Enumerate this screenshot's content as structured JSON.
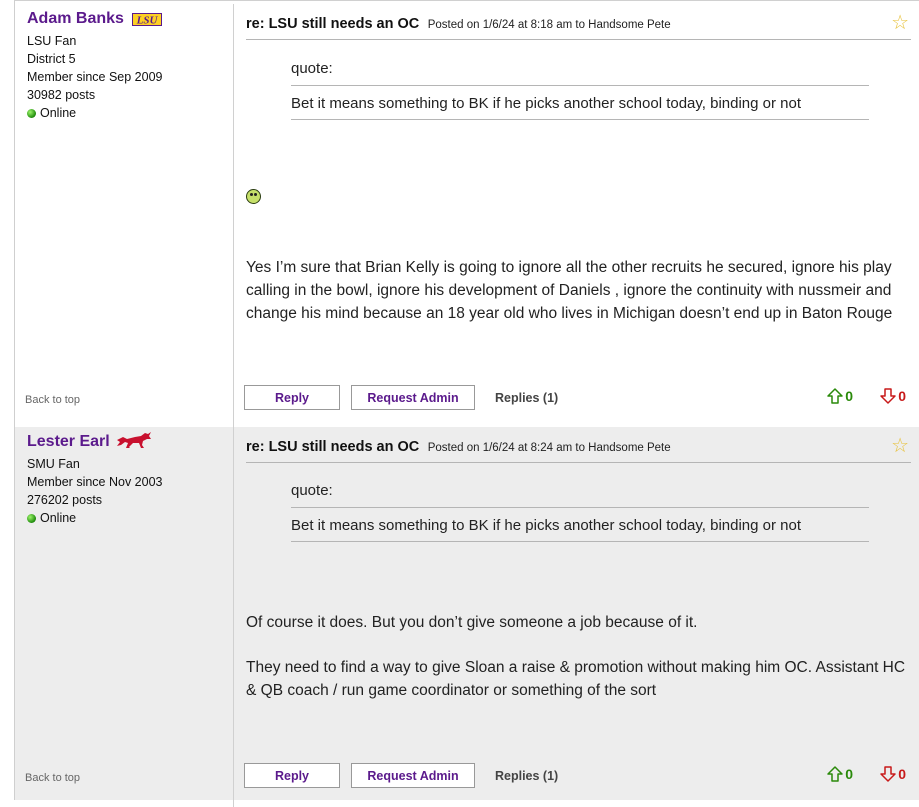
{
  "posts": [
    {
      "author": "Adam Banks",
      "team_logo": "LSU",
      "fan_of": "LSU Fan",
      "district": "District 5",
      "member_since": "Member since Sep 2009",
      "post_count": "30982 posts",
      "status": "Online",
      "subject": "re: LSU still needs an OC",
      "posted_info": "Posted on 1/6/24 at 8:18 am to Handsome Pete",
      "quote_label": "quote:",
      "quote_text": "Bet it means something to BK if he picks another school today, binding or not",
      "emoji_icon": "nerd-smiley-icon",
      "paragraphs": [
        "Yes I’m sure that Brian Kelly is going to ignore all the other recruits he secured, ignore his play calling in the bowl, ignore his development of Daniels , ignore the continuity with nussmeir and change his mind because an 18 year old who lives in Michigan doesn’t end up in Baton Rouge"
      ],
      "back_to_top": "Back to top",
      "reply_label": "Reply",
      "request_admin_label": "Request Admin",
      "replies_label": "Replies (1)",
      "upvotes": "0",
      "downvotes": "0"
    },
    {
      "author": "Lester Earl",
      "team_logo": "SMU mustang",
      "fan_of": "SMU Fan",
      "member_since": "Member since Nov 2003",
      "post_count": "276202 posts",
      "status": "Online",
      "subject": "re: LSU still needs an OC",
      "posted_info": "Posted on 1/6/24 at 8:24 am to Handsome Pete",
      "quote_label": "quote:",
      "quote_text": "Bet it means something to BK if he picks another school today, binding or not",
      "paragraphs": [
        "Of course it does. But you don’t give someone a job because of it.",
        "They need to find a way to give Sloan a raise & promotion without making him OC. Assistant HC & QB coach / run game coordinator or something of the sort"
      ],
      "back_to_top": "Back to top",
      "reply_label": "Reply",
      "request_admin_label": "Request Admin",
      "replies_label": "Replies (1)",
      "upvotes": "0",
      "downvotes": "0"
    }
  ],
  "colors": {
    "author_name": "#5b1a8c",
    "upvote": "#2a8a0a",
    "downvote": "#c81a1a",
    "alt_row": "#ededed"
  }
}
